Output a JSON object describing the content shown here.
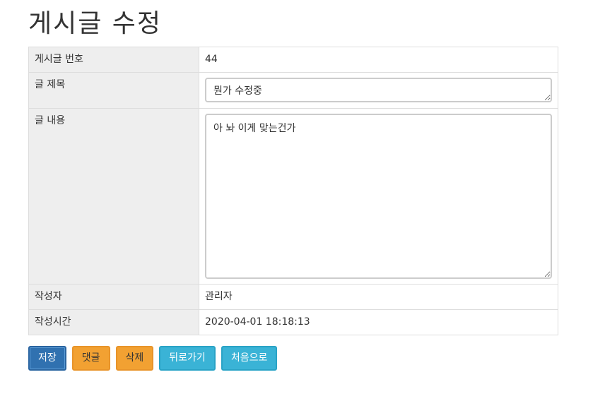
{
  "page": {
    "title": "게시글 수정"
  },
  "table": {
    "rows": [
      {
        "label": "게시글 번호",
        "value": "44"
      },
      {
        "label": "글 제목",
        "value": "뭔가 수정중"
      },
      {
        "label": "글 내용",
        "value": "아 놔 이게 맞는건가"
      },
      {
        "label": "작성자",
        "value": "관리자"
      },
      {
        "label": "작성시간",
        "value": "2020-04-01 18:18:13"
      }
    ]
  },
  "buttons": {
    "save": "저장",
    "reply": "댓글",
    "delete": "삭제",
    "back": "뒤로가기",
    "home": "처음으로"
  },
  "colors": {
    "primary": "#3071b0",
    "warning": "#f2a132",
    "info": "#3ab3d6",
    "label_bg": "#eeeeee"
  }
}
